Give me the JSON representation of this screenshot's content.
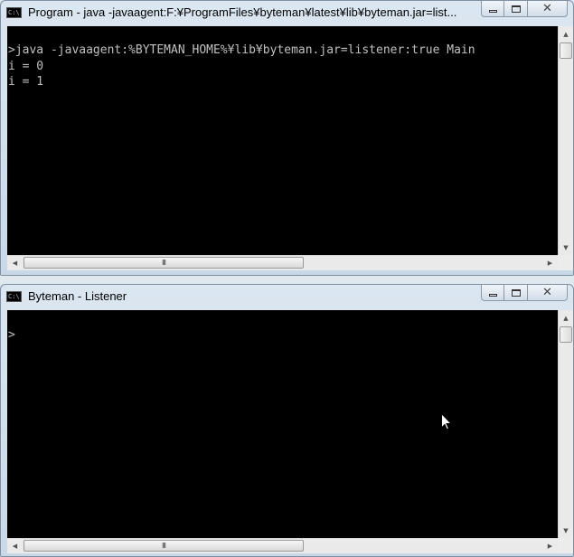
{
  "windows": [
    {
      "title": "Program - java  -javaagent:F:¥ProgramFiles¥byteman¥latest¥lib¥byteman.jar=list...",
      "icon": "console-app-icon",
      "console_text": ">java -javaagent:%BYTEMAN_HOME%¥lib¥byteman.jar=listener:true Main\ni = 0\ni = 1"
    },
    {
      "title": "Byteman - Listener",
      "icon": "console-app-icon",
      "console_text": ">"
    }
  ],
  "icon_labels": {
    "console_icon": "C:\\",
    "minimize": "",
    "maximize": "",
    "close": "✕",
    "up_arrow": "▲",
    "down_arrow": "▼",
    "left_arrow": "◀",
    "right_arrow": "▶",
    "thumb_grip": "III"
  },
  "colors": {
    "console_bg": "#000000",
    "console_fg": "#c0c0c0",
    "window_frame": "#c9d8e8"
  }
}
